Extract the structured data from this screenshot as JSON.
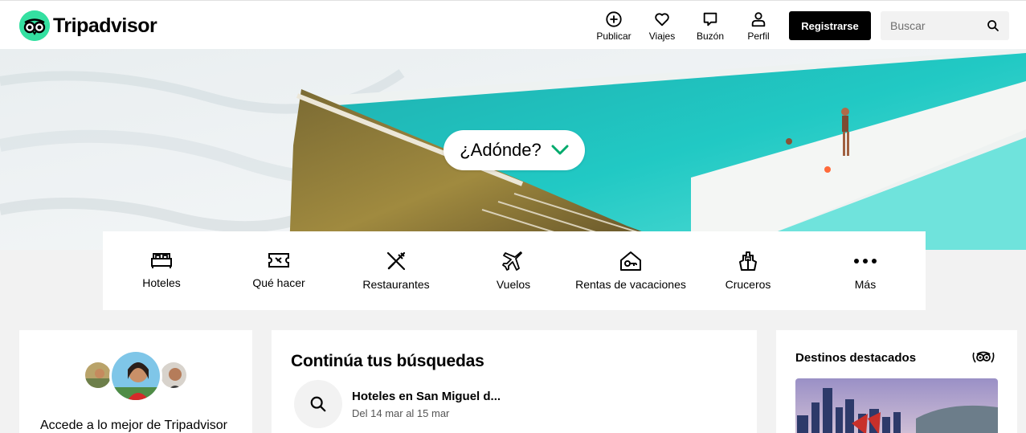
{
  "header": {
    "logo_text": "Tripadvisor",
    "nav": [
      {
        "label": "Publicar",
        "icon": "plus-circle-icon"
      },
      {
        "label": "Viajes",
        "icon": "heart-icon"
      },
      {
        "label": "Buzón",
        "icon": "message-icon"
      },
      {
        "label": "Perfil",
        "icon": "user-icon"
      }
    ],
    "register_label": "Registrarse",
    "search_placeholder": "Buscar"
  },
  "hero": {
    "where_label": "¿Adónde?"
  },
  "categories": [
    {
      "label": "Hoteles",
      "icon": "bed-icon"
    },
    {
      "label": "Qué hacer",
      "icon": "ticket-icon"
    },
    {
      "label": "Restaurantes",
      "icon": "fork-knife-icon"
    },
    {
      "label": "Vuelos",
      "icon": "plane-icon"
    },
    {
      "label": "Rentas de vacaciones",
      "icon": "house-key-icon"
    },
    {
      "label": "Cruceros",
      "icon": "ship-icon"
    },
    {
      "label": "Más",
      "icon": "more-dots-icon"
    }
  ],
  "signin_card": {
    "text": "Accede a lo mejor de Tripadvisor"
  },
  "recent_searches": {
    "title": "Continúa tus búsquedas",
    "items": [
      {
        "title": "Hoteles en San Miguel d...",
        "dates": "Del 14 mar al 15 mar"
      }
    ]
  },
  "featured_destinations": {
    "title": "Destinos destacados"
  },
  "colors": {
    "brand_green": "#34e0a1",
    "accent_dark": "#000000",
    "pill_chevron": "#00aa6c"
  }
}
